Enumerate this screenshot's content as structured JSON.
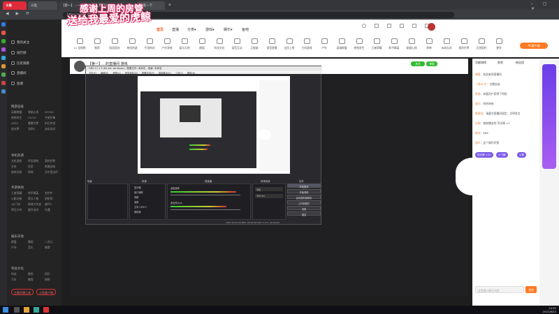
{
  "browser": {
    "tabs": [
      {
        "label": "斗鱼",
        "active": false
      },
      {
        "label": "【第一】…一周UP主名称_我们Up主",
        "active": true
      },
      {
        "label": "百度一下",
        "active": false
      }
    ],
    "url": "https://www.douyu.com/…",
    "colors": {
      "tabbar": "#35363a",
      "addr": "#3c3d41"
    }
  },
  "overlay": {
    "thanks": "感谢上周的房管",
    "sponsor": "送给我最爱的虎鲸"
  },
  "site": {
    "logo": "斗鱼",
    "nav": [
      "首页",
      "直播",
      "分类▾",
      "游戏▾",
      "娱乐▾",
      "鱼吧"
    ],
    "categories": [
      "12 定制榜",
      "推荐",
      "网游竞技",
      "单机热游",
      "手游休闲",
      "户外游戏",
      "娱乐天地",
      "颜值",
      "科技文化",
      "语音互动",
      "正能量",
      "语音直播",
      "全民上榜",
      "主机游戏",
      "户外",
      "英雄联盟",
      "绝地求生",
      "王者荣耀",
      "和平精英",
      "穿越火线",
      "原神",
      "永劫无间",
      "我的世界",
      "无畏契约",
      "更多"
    ],
    "promo": "PC客户端"
  },
  "leftnav": {
    "top_items": [
      "我的关注",
      "排行榜",
      "历史观看",
      "直播间",
      "鱼塘"
    ],
    "sections": [
      {
        "title": "网游竞技",
        "cells": [
          "英雄联盟",
          "穿越火线",
          "DOTA2",
          "绝地求生",
          "CS:GO",
          "守望先锋",
          "APEX",
          "魔兽世界",
          "炉石传说",
          "逆水寒",
          "剑网3",
          "永劫无间"
        ]
      },
      {
        "title": "单机热游",
        "cells": [
          "主机游戏",
          "怀旧游戏",
          "我的世界",
          "方舟",
          "饥荒",
          "刺激战场",
          "使命召唤",
          "原神",
          "艾尔登法环"
        ]
      },
      {
        "title": "手游休闲",
        "cells": [
          "王者荣耀",
          "和平精英",
          "金铲铲",
          "火影忍者",
          "第五人格",
          "阴阳师",
          "QQ飞车",
          "球球大作战",
          "崩坏3",
          "明日方舟",
          "蛋仔派对",
          "光遇"
        ]
      },
      {
        "title": "娱乐天地",
        "cells": [
          "颜值",
          "舞蹈",
          "二次元",
          "户外",
          "音乐",
          "美食"
        ]
      },
      {
        "title": "科技文化",
        "cells": [
          "科技",
          "数码",
          "知识",
          "汽车",
          "教育",
          "财经"
        ]
      }
    ],
    "buttons": [
      "主播开播工具",
      "斗鱼客户端"
    ]
  },
  "stream": {
    "title": "【第一】…的直播间 游戏",
    "subtitle": "主播·关注·在线·分享",
    "follow": "关注",
    "report": "举报"
  },
  "obs": {
    "title": "OBS 27.1.3 (64-bit, windows) - 配置文件: 未命名 - 场景: 未命名",
    "menu": [
      "文件(F)",
      "编辑(E)",
      "视图(V)",
      "停靠部件(D)",
      "配置文件(P)",
      "场景集合(S)",
      "工具(T)",
      "帮助(H)"
    ],
    "docks": [
      "场景",
      "来源",
      "混音器",
      "转场特效",
      "控件"
    ],
    "sources": [
      "显示器",
      "窗口捕获",
      "视频",
      "音频",
      "文本 (GDI+)",
      "媒体源"
    ],
    "mixer": [
      "桌面音频",
      "麦克风/Aux"
    ],
    "transition": "淡出",
    "duration": "300 ms",
    "controls": [
      "开始推流",
      "开始录制",
      "启动虚拟摄像机",
      "工作室模式",
      "设置",
      "退出"
    ],
    "status": "LIVE: 00:00:00  REC: 00:00:00  CPU: 3.2%, 30.00 fps"
  },
  "chat": {
    "tabs": [
      "贡献周榜",
      "贵宾",
      "粉丝团"
    ],
    "lines": [
      {
        "name": "弹幕",
        "text": "欢迎来到直播间"
      },
      {
        "name": "一周UP主",
        "text": "主播加油"
      },
      {
        "name": "系统",
        "text": "恭喜用户获得了特权"
      },
      {
        "name": "观众",
        "text": "哈哈哈哈"
      },
      {
        "name": "管理员",
        "text": "请遵守直播间规定，文明发言"
      },
      {
        "name": "礼物",
        "text": "感谢赠送的 荧光棒 ×1"
      },
      {
        "name": "粉丝",
        "text": "666"
      },
      {
        "name": "观众",
        "text": "这个操作厉害"
      }
    ],
    "gifts": [
      "荧光棒 ×10",
      "小飞碟",
      "火箭"
    ],
    "input_placeholder": "这里输入聊天内容",
    "send": "发送"
  },
  "taskbar": {
    "time": "14:32",
    "date": "2022/8/24"
  }
}
